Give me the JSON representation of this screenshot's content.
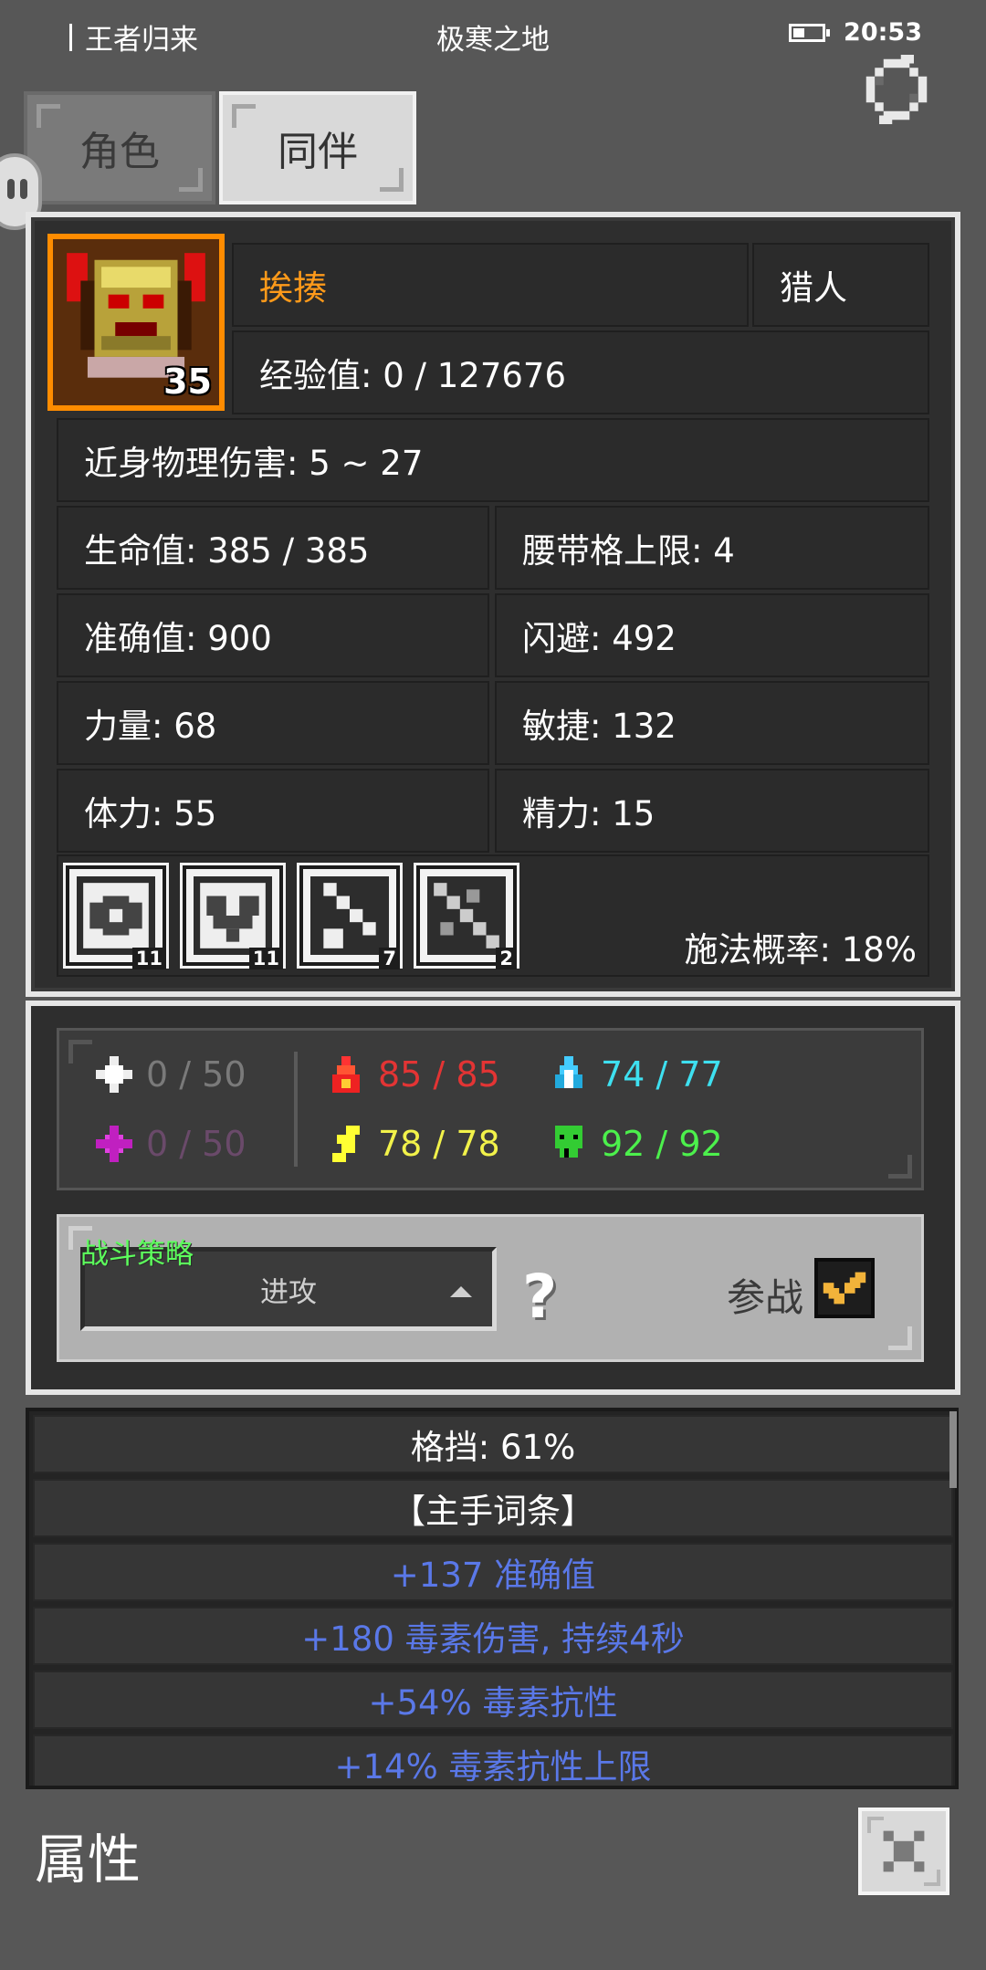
{
  "status_bar": {
    "app": "王者归来",
    "location": "极寒之地",
    "time": "20:53"
  },
  "tabs": [
    {
      "label": "角色"
    },
    {
      "label": "同伴"
    }
  ],
  "companion": {
    "name": "挨揍",
    "class": "猎人",
    "level": "35",
    "exp": "经验值: 0 / 127676",
    "melee": "近身物理伤害: 5 ~ 27",
    "stats": [
      [
        "生命值: 385 / 385",
        "腰带格上限: 4"
      ],
      [
        "准确值: 900",
        "闪避: 492"
      ],
      [
        "力量: 68",
        "敏捷: 132"
      ],
      [
        "体力: 55",
        "精力: 15"
      ]
    ],
    "skills": [
      "11",
      "11",
      "7",
      "2"
    ],
    "cast_rate": "施法概率: 18%"
  },
  "resistances": {
    "physical": "0 / 50",
    "fire": "85 / 85",
    "cold": "74 / 77",
    "magic": "0 / 50",
    "lightning": "78 / 78",
    "poison": "92 / 92"
  },
  "colors": {
    "physical": "#7a7a7a",
    "fire": "#e33434",
    "cold": "#3ee0f0",
    "magic": "#6a4a6a",
    "lightning": "#f2f24a",
    "poison": "#4cf04c",
    "name": "#ff9a1a",
    "affix": "#5a78e8"
  },
  "strategy": {
    "label": "战斗策略",
    "value": "进攻",
    "join": "参战"
  },
  "item_lines": [
    {
      "text": "格挡: 61%",
      "color": "#ffffff"
    },
    {
      "text": "【主手词条】",
      "color": "#ffffff"
    },
    {
      "text": "+137 准确值",
      "color": "#5a78e8"
    },
    {
      "text": "+180 毒素伤害, 持续4秒",
      "color": "#5a78e8"
    },
    {
      "text": "+54% 毒素抗性",
      "color": "#5a78e8"
    },
    {
      "text": "+14% 毒素抗性上限",
      "color": "#5a78e8"
    }
  ],
  "footer": {
    "title": "属性"
  }
}
